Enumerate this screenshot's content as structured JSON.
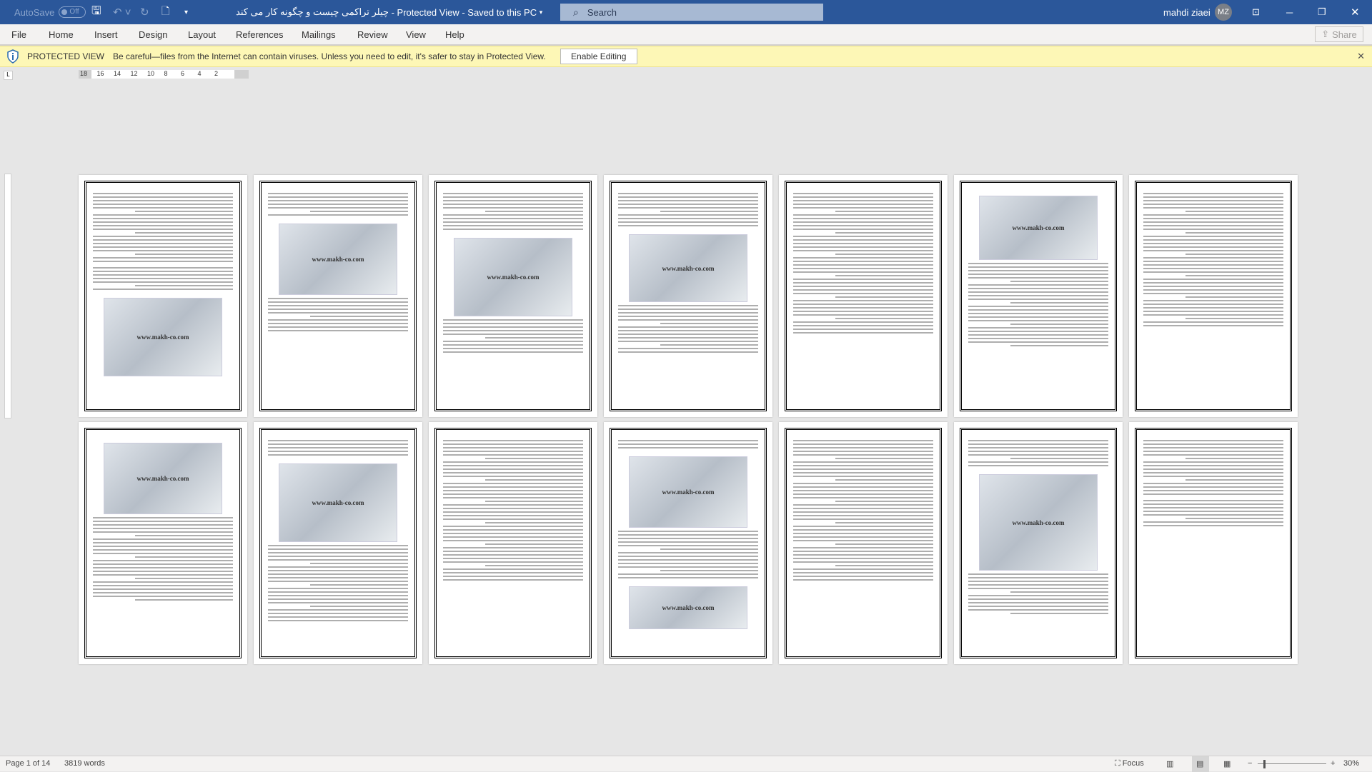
{
  "titlebar": {
    "autosave": "AutoSave",
    "autosave_state": "Off",
    "doc_title": "چیلر تراکمی چیست و چگونه کار می کند",
    "title_suffix": "- Protected View - Saved to this PC",
    "search_placeholder": "Search",
    "user_name": "mahdi ziaei",
    "user_initials": "MZ"
  },
  "menu": {
    "tabs": [
      "File",
      "Home",
      "Insert",
      "Design",
      "Layout",
      "References",
      "Mailings",
      "Review",
      "View",
      "Help"
    ],
    "share": "Share"
  },
  "protected_view": {
    "title": "PROTECTED VIEW",
    "message": "Be careful—files from the Internet can contain viruses. Unless you need to edit, it's safer to stay in Protected View.",
    "button": "Enable Editing"
  },
  "ruler": {
    "numbers": [
      "18",
      "16",
      "14",
      "12",
      "10",
      "8",
      "6",
      "4",
      "2"
    ]
  },
  "watermark": "www.makh-co.com",
  "status": {
    "page": "Page 1 of 14",
    "words": "3819 words",
    "focus": "Focus",
    "zoom": "30%"
  },
  "page_count": 14
}
